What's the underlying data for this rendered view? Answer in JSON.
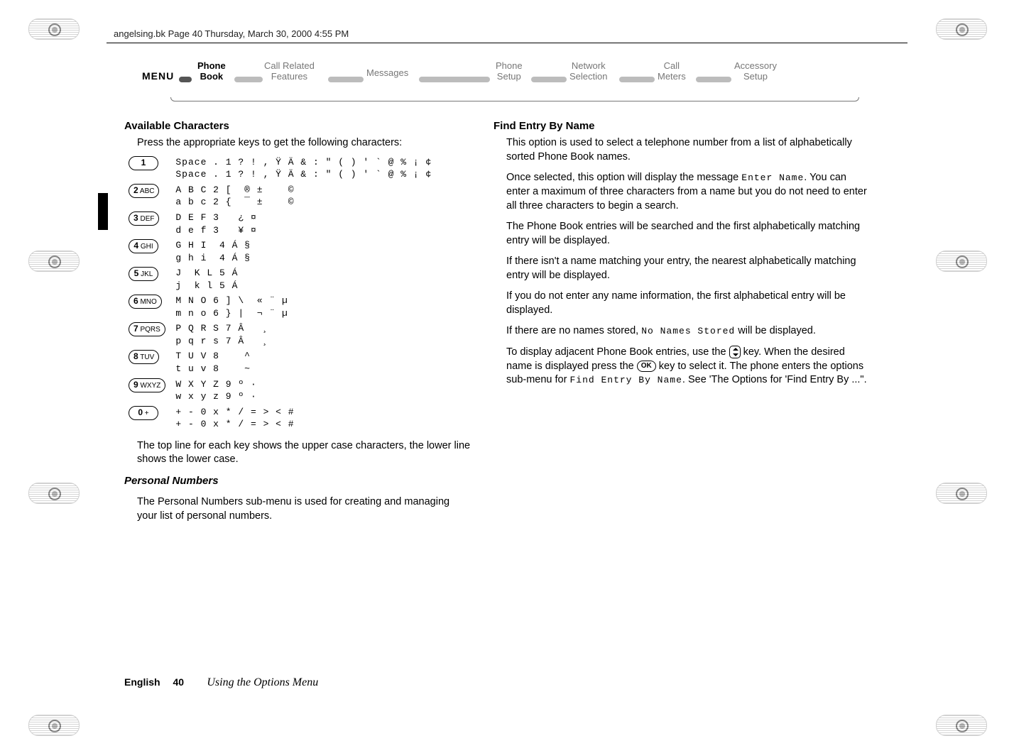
{
  "header_line": "angelsing.bk  Page 40  Thursday, March 30, 2000  4:55 PM",
  "ribbon": {
    "menu": "MENU",
    "items": [
      {
        "line1": "Phone",
        "line2": "Book",
        "active": true
      },
      {
        "line1": "Call Related",
        "line2": "Features",
        "active": false
      },
      {
        "line1": "Messages",
        "line2": "",
        "active": false
      },
      {
        "line1": "Phone",
        "line2": "Setup",
        "active": false
      },
      {
        "line1": "Network",
        "line2": "Selection",
        "active": false
      },
      {
        "line1": "Call",
        "line2": "Meters",
        "active": false
      },
      {
        "line1": "Accessory",
        "line2": "Setup",
        "active": false
      }
    ]
  },
  "left": {
    "h_chars": "Available Characters",
    "intro": "Press the appropriate keys to get the following characters:",
    "keys": [
      {
        "label": "1",
        "upper": "Space . 1 ? ! , Ÿ Ä & : \" ( ) ' ` @ % ¡ ¢",
        "lower": "Space . 1 ? ! , Ÿ Ä & : \" ( ) ' ` @ % ¡ ¢"
      },
      {
        "label": "2 ABC",
        "upper": "A B C 2 [  ® ±    ©",
        "lower": "a b c 2 {  ¯ ±    ©"
      },
      {
        "label": "3 DEF",
        "upper": "D E F 3   ¿ ¤",
        "lower": "d e f 3   ¥ ¤"
      },
      {
        "label": "4 GHI",
        "upper": "G H I  4 Á §",
        "lower": "g h i  4 Á §"
      },
      {
        "label": "5 JKL",
        "upper": "J  K L 5 Á",
        "lower": "j  k l 5 Á"
      },
      {
        "label": "6 MNO",
        "upper": "M N O 6 ] \\  « ¨ µ",
        "lower": "m n o 6 } |  ¬ ¨ µ"
      },
      {
        "label": "7 PQRS",
        "upper": "P Q R S 7 Â   ¸",
        "lower": "p q r s 7 Â   ¸"
      },
      {
        "label": "8 TUV",
        "upper": "T U V 8    ^",
        "lower": "t u v 8    ~"
      },
      {
        "label": "9 WXYZ",
        "upper": "W X Y Z 9 º ·",
        "lower": "w x y z 9 º ·"
      },
      {
        "label": "0 +",
        "upper": "+ - 0 x * / = > < #",
        "lower": "+ - 0 x * / = > < #"
      }
    ],
    "note": "The top line for each key shows the upper case characters, the lower line shows the lower case.",
    "h_personal": "Personal Numbers",
    "personal_body": "The Personal Numbers sub-menu is used for creating and managing your list of personal numbers."
  },
  "right": {
    "h_find": "Find Entry By Name",
    "p1": "This option is used to select a telephone number from a list of alphabetically sorted Phone Book names.",
    "p2a": "Once selected, this option will display the message ",
    "p2_code": "Enter Name",
    "p2b": ". You can enter a maximum of three characters from a name but you do not need to enter all three characters to begin a search.",
    "p3": "The Phone Book entries will be searched and the first alphabetically matching entry will be displayed.",
    "p4": "If there isn't a name matching your entry, the nearest alphabetically matching entry will be displayed.",
    "p5": "If you do not enter any name information, the first alphabetical entry will be displayed.",
    "p6a": "If there are no names stored, ",
    "p6_code": "No Names Stored",
    "p6b": " will be displayed.",
    "p7a": "To display adjacent Phone Book entries, use the ",
    "p7b": " key. When the desired name is displayed press the ",
    "p7_ok": "OK",
    "p7c": " key to select it. The phone enters the options sub-menu for ",
    "p7_code": "Find Entry By Name",
    "p7d": ". See 'The Options for 'Find Entry By ...\"."
  },
  "footer": {
    "english": "English",
    "page": "40",
    "chapter": "Using the Options Menu"
  }
}
